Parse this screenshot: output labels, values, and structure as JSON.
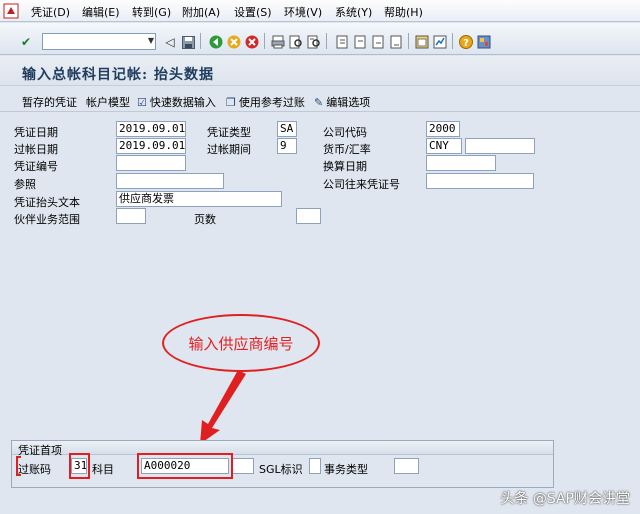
{
  "menu": {
    "items": [
      "凭证(D)",
      "编辑(E)",
      "转到(G)",
      "附加(A)",
      "设置(S)",
      "环境(V)",
      "系统(Y)",
      "帮助(H)"
    ]
  },
  "toolbar": {
    "command_value": ""
  },
  "page": {
    "title": "输入总帐科目记帐: 抬头数据"
  },
  "app_toolbar": {
    "held_doc": "暂存的凭证",
    "acct_model": "帐户模型",
    "fast_entry": "快速数据输入",
    "post_with_ref": "使用参考过账",
    "edit_options": "编辑选项"
  },
  "header": {
    "doc_date_label": "凭证日期",
    "doc_date": "2019.09.01",
    "doc_type_label": "凭证类型",
    "doc_type": "SA",
    "company_code_label": "公司代码",
    "company_code": "2000",
    "posting_date_label": "过帐日期",
    "posting_date": "2019.09.01",
    "period_label": "过帐期间",
    "period": "9",
    "currency_label": "货币/汇率",
    "currency": "CNY",
    "exchange_rate": "",
    "doc_number_label": "凭证编号",
    "doc_number": "",
    "translation_date_label": "换算日期",
    "translation_date": "",
    "reference_label": "参照",
    "reference": "",
    "intercompany_label": "公司往来凭证号",
    "intercompany": "",
    "header_text_label": "凭证抬头文本",
    "header_text": "供应商发票",
    "trading_partner_label": "伙伴业务范围",
    "trading_partner": "",
    "page_label": "页数",
    "page_no": ""
  },
  "annotation": {
    "callout_text": "输入供应商编号"
  },
  "first_item": {
    "group_title": "凭证首项",
    "posting_key_label": "过账码",
    "posting_key": "31",
    "account_label": "科目",
    "account": "A000020",
    "account_ext": "",
    "sgl_label": "SGL标识",
    "sgl": "",
    "trans_type_label": "事务类型",
    "trans_type": ""
  },
  "watermark": {
    "text": "头条 @SAP财会讲堂"
  },
  "colors": {
    "background": "#dfe6ef",
    "highlight": "#e02020",
    "title": "#1f3b5d"
  }
}
